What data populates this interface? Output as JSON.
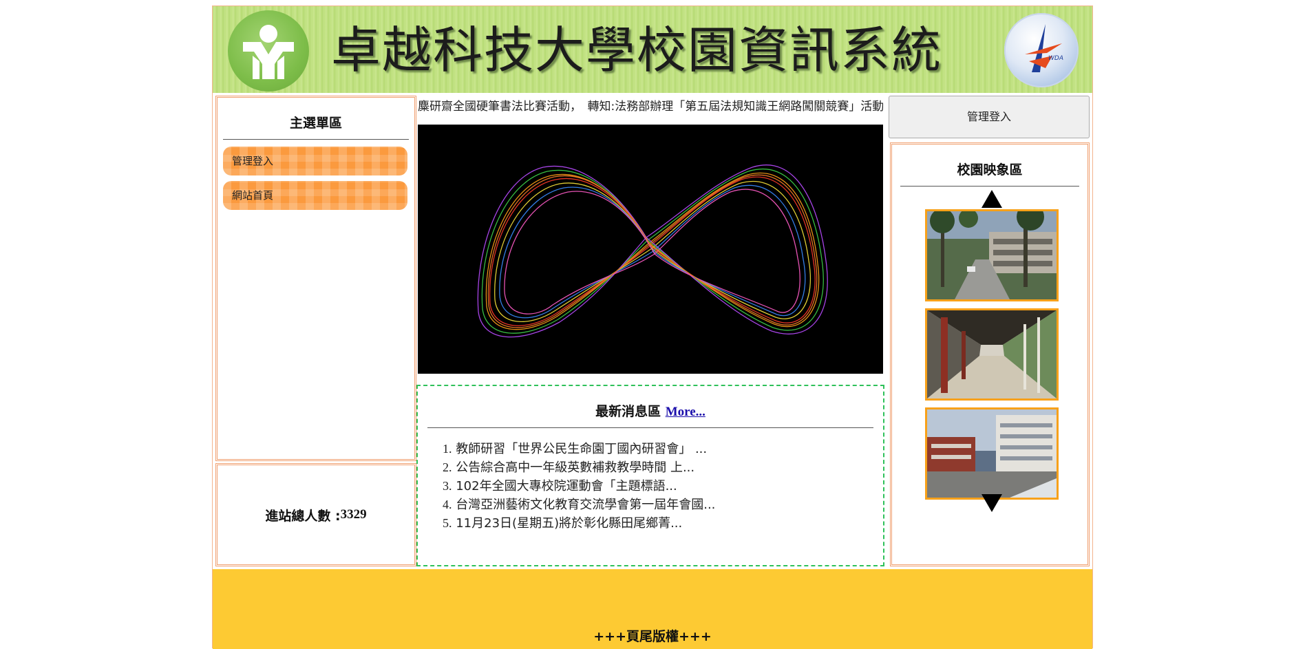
{
  "header": {
    "site_title": "卓越科技大學校園資訊系統",
    "left_logo": "school-emblem",
    "right_logo": "partner-emblem"
  },
  "sidebar": {
    "menu_title": "主選單區",
    "items": [
      {
        "label": "管理登入"
      },
      {
        "label": "網站首頁"
      }
    ],
    "counter_label": "進站總人數 :",
    "counter_value": "3329"
  },
  "main": {
    "marquee_text": "麋研齋全國硬筆書法比賽活動，　轉知:法務部辦理「第五屆法規知識王網路闖關競賽」活動",
    "news": {
      "title": "最新消息區",
      "more_label": "More...",
      "items": [
        {
          "num": "1.",
          "text": "教師研習「世界公民生命園丁國內研習會」 ..."
        },
        {
          "num": "2.",
          "text": "公告綜合高中一年級英數補救教學時間 上..."
        },
        {
          "num": "3.",
          "text": "102年全國大專校院運動會「主題標語..."
        },
        {
          "num": "4.",
          "text": "台灣亞洲藝術文化教育交流學會第一屆年會國..."
        },
        {
          "num": "5.",
          "text": "11月23日(星期五)將於彰化縣田尾鄉菁..."
        }
      ]
    }
  },
  "right": {
    "admin_button": "管理登入",
    "campus_title": "校園映象區",
    "photos": [
      "campus-road-photo",
      "corridor-photo",
      "buildings-photo"
    ]
  },
  "footer": {
    "text": "+++頁尾版權+++"
  },
  "colors": {
    "header_green": "#bfe07e",
    "menu_orange": "#fb9a3e",
    "box_border": "#f0a070",
    "news_border": "#2fc15a",
    "photo_border": "#f7a11a",
    "footer_yellow": "#fdca33"
  }
}
